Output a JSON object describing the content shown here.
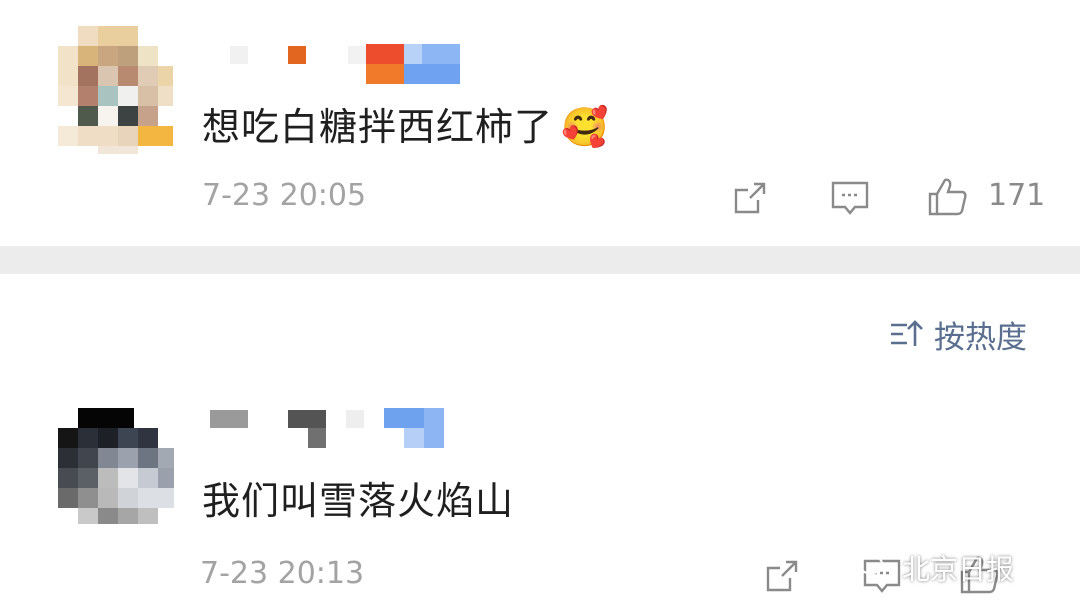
{
  "comments": [
    {
      "text": "想吃白糖拌西红柿了",
      "emoji": "🥰",
      "timestamp": "7-23 20:05",
      "likes": "171"
    },
    {
      "text": "我们叫雪落火焰山",
      "timestamp": "7-23 20:13"
    }
  ],
  "sort": {
    "label": "按热度"
  },
  "watermark": {
    "label": "北京日报"
  },
  "colors": {
    "text": "#1f1f1f",
    "meta": "#a3a3a3",
    "icon": "#8a8a8a",
    "accent": "#5a6f8f",
    "divider": "#ececec"
  }
}
